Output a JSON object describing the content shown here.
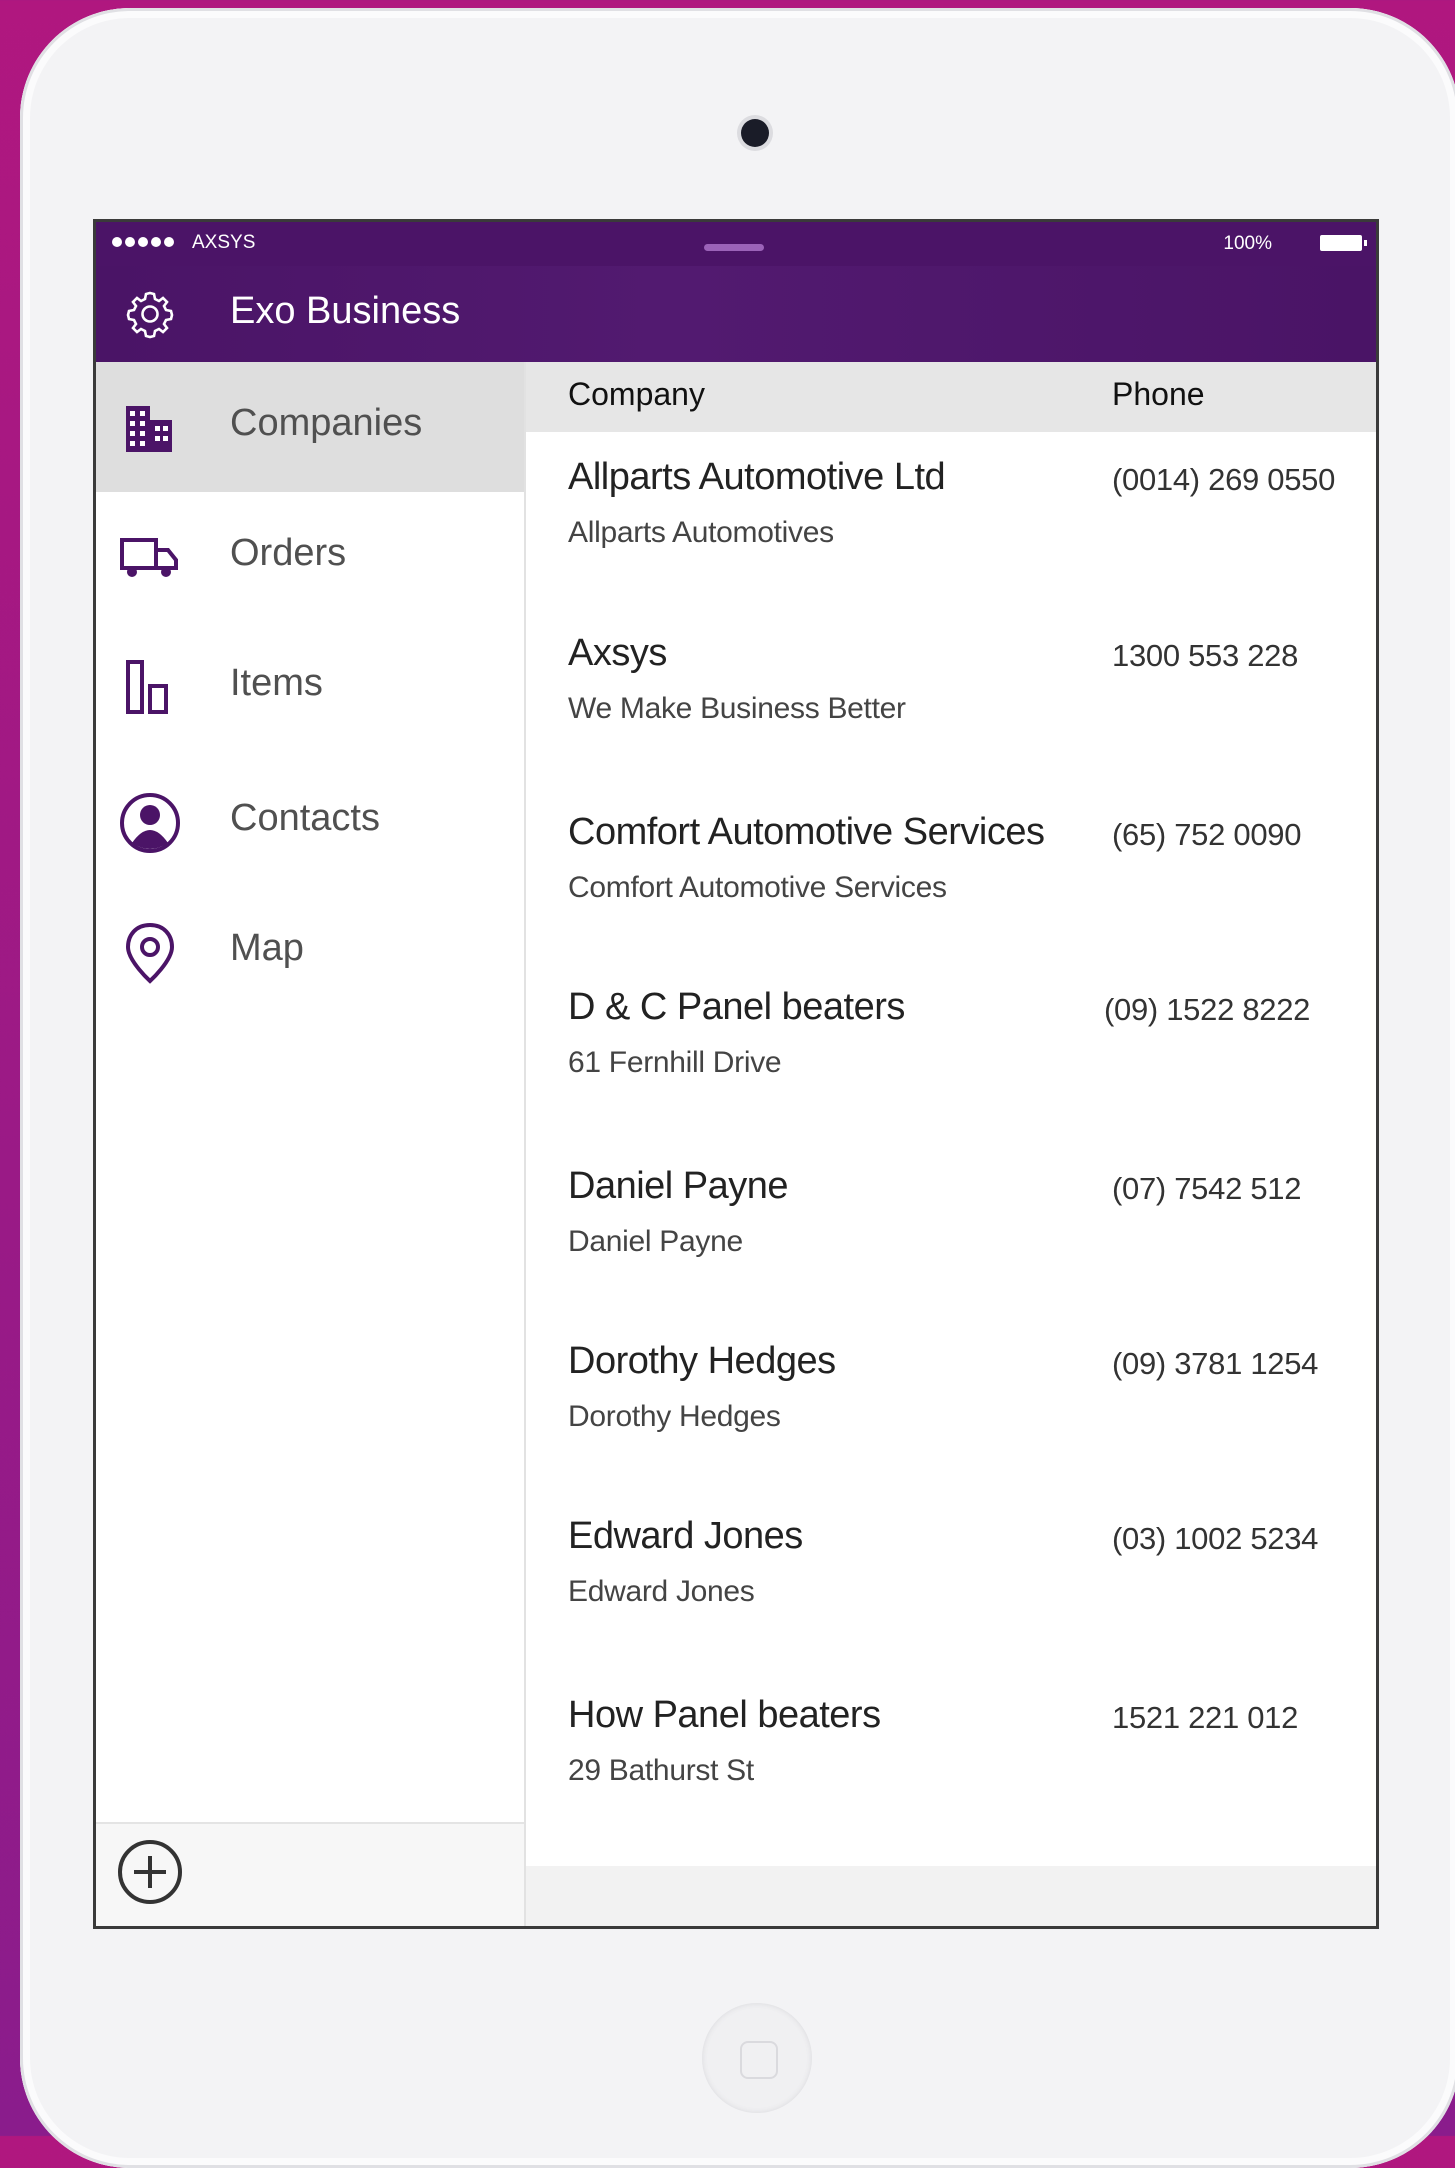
{
  "status_bar": {
    "carrier": "AXSYS",
    "battery": "100%"
  },
  "app": {
    "title": "Exo Business"
  },
  "sidebar": {
    "items": [
      {
        "label": "Companies",
        "icon": "building-icon",
        "active": true
      },
      {
        "label": "Orders",
        "icon": "truck-icon",
        "active": false
      },
      {
        "label": "Items",
        "icon": "items-icon",
        "active": false
      },
      {
        "label": "Contacts",
        "icon": "person-icon",
        "active": false
      },
      {
        "label": "Map",
        "icon": "map-pin-icon",
        "active": false
      }
    ]
  },
  "list": {
    "headers": {
      "company": "Company",
      "phone": "Phone"
    },
    "rows": [
      {
        "company": "Allparts Automotive Ltd",
        "subtitle": "Allparts Automotives",
        "phone": "(0014) 269 0550"
      },
      {
        "company": "Axsys",
        "subtitle": "We Make Business Better",
        "phone": "1300 553 228"
      },
      {
        "company": "Comfort Automotive Services",
        "subtitle": "Comfort  Automotive Services",
        "phone": "(65) 752 0090"
      },
      {
        "company": "D & C Panel beaters",
        "subtitle": "61 Fernhill Drive",
        "phone": "(09) 1522 8222"
      },
      {
        "company": "Daniel Payne",
        "subtitle": "Daniel Payne",
        "phone": "(07) 7542 512"
      },
      {
        "company": "Dorothy Hedges",
        "subtitle": "Dorothy Hedges",
        "phone": "(09) 3781 1254"
      },
      {
        "company": "Edward Jones",
        "subtitle": "Edward Jones",
        "phone": "(03) 1002 5234"
      },
      {
        "company": "How Panel beaters",
        "subtitle": "29 Bathurst St",
        "phone": "1521 221 012"
      }
    ]
  },
  "colors": {
    "brand": "#4b1467",
    "icon": "#4b1467",
    "active_bg": "#dedede",
    "background": "#a0197f"
  }
}
